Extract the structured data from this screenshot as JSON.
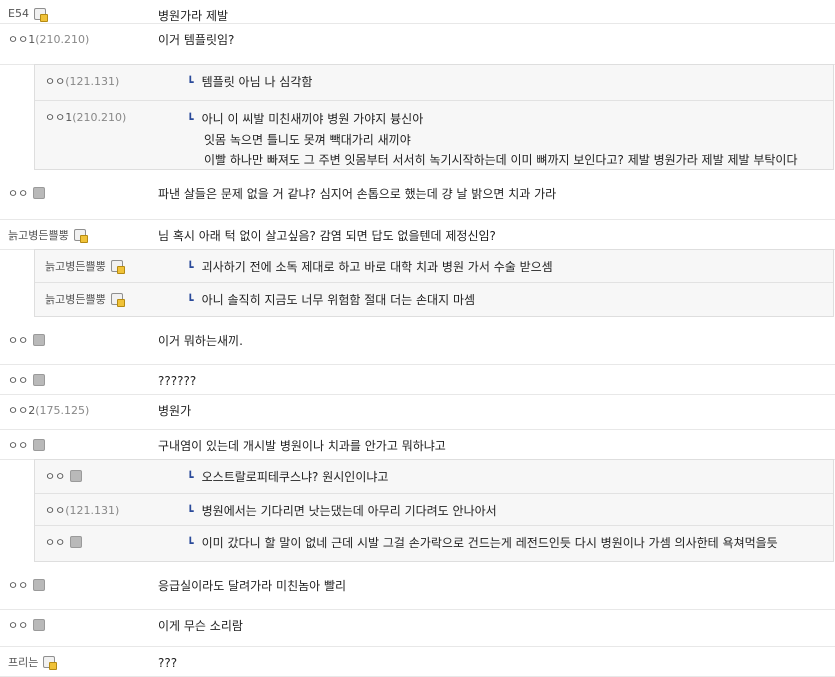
{
  "comments": [
    {
      "nick": "E54",
      "icon": "fixed",
      "text": "병원가라 제발"
    },
    {
      "nick": "ㅇㅇ1",
      "ip": "(210.210)",
      "text": "이거 템플릿임?",
      "replies": [
        {
          "nick": "ㅇㅇ",
          "ip": "(121.131)",
          "lines": [
            "템플릿 아님 나 심각함"
          ]
        },
        {
          "nick": "ㅇㅇ1",
          "ip": "(210.210)",
          "lines": [
            "아니 이 씨발 미친새끼야 병원 가야지 븅신아",
            "잇몸 녹으면 틀니도 못껴 빽대가리 새끼야",
            "이빨 하나만 빠져도 그 주변 잇몸부터 서서히 녹기시작하는데 이미 뼈까지 보인다고? 제발 병원가라 제발 제발 부탁이다"
          ]
        }
      ]
    },
    {
      "nick": "ㅇㅇ",
      "icon": "gray",
      "text": "파낸 살들은 문제 없을 거 같냐? 심지어 손톱으로 했는데 걍 날 밝으면 치과 가라"
    },
    {
      "nick": "늙고병든쁠뿡",
      "icon": "fixed",
      "text": "님 혹시 아래 턱 없이 살고싶음? 감염 되면 답도 없을텐데 제정신임?",
      "replies": [
        {
          "nick": "늙고병든쁠뿡",
          "icon": "fixed",
          "lines": [
            "괴사하기 전에 소독 제대로 하고 바로 대학 치과 병원 가서 수술 받으셈"
          ]
        },
        {
          "nick": "늙고병든쁠뿡",
          "icon": "fixed",
          "lines": [
            "아니 솔직히 지금도 너무 위험함 절대 더는 손대지 마셈"
          ]
        }
      ]
    },
    {
      "nick": "ㅇㅇ",
      "icon": "gray",
      "text": "이거 뭐하는새끼."
    },
    {
      "nick": "ㅇㅇ",
      "icon": "gray",
      "text": "??????"
    },
    {
      "nick": "ㅇㅇ2",
      "ip": "(175.125)",
      "text": "병원가"
    },
    {
      "nick": "ㅇㅇ",
      "icon": "gray",
      "text": "구내염이 있는데 개시발 병원이나 치과를 안가고 뭐하냐고",
      "replies": [
        {
          "nick": "ㅇㅇ",
          "icon": "gray",
          "lines": [
            "오스트랄로피테쿠스냐? 원시인이냐고"
          ]
        },
        {
          "nick": "ㅇㅇ",
          "ip": "(121.131)",
          "lines": [
            "병원에서는 기다리면 낫는댔는데 아무리 기다려도 안나아서"
          ]
        },
        {
          "nick": "ㅇㅇ",
          "icon": "gray",
          "lines": [
            "이미 갔다니 할 말이 없네 근데 시발 그걸 손가락으로 건드는게 레전드인듯 다시 병원이나 가셈 의사한테 욕쳐먹을듯"
          ]
        }
      ]
    },
    {
      "nick": "ㅇㅇ",
      "icon": "gray",
      "text": "응급실이라도 달려가라 미친놈아 빨리"
    },
    {
      "nick": "ㅇㅇ",
      "icon": "gray",
      "text": "이게 무슨 소리람"
    },
    {
      "nick": "프리는",
      "icon": "fixed",
      "text": "???"
    }
  ]
}
